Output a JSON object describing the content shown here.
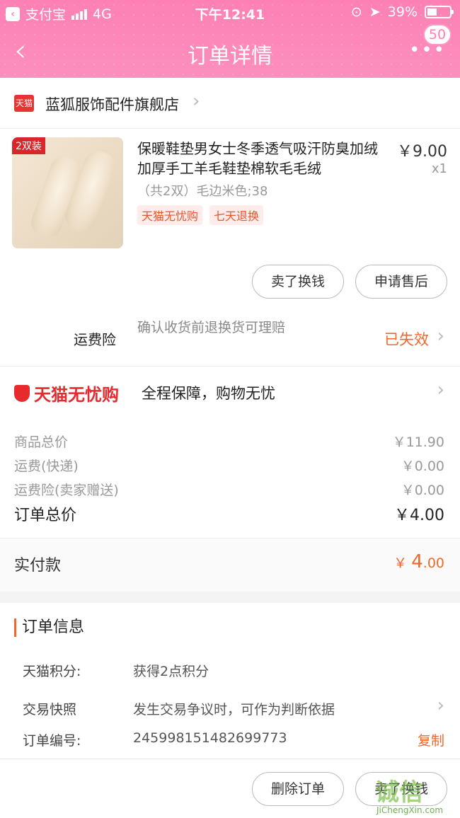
{
  "status_bar": {
    "carrier": "支付宝",
    "network": "4G",
    "time": "下午12:41",
    "battery": "39%"
  },
  "nav": {
    "title": "订单详情",
    "badge": "50",
    "more_label": "•••"
  },
  "shop": {
    "logo_text": "天猫",
    "name": "蓝狐服饰配件旗舰店"
  },
  "product": {
    "image_tag": "2双装",
    "title": "保暖鞋垫男女士冬季透气吸汗防臭加绒加厚手工羊毛鞋垫棉软毛毛绒",
    "spec": "（共2双）毛边米色;38",
    "tags": [
      "天猫无忧购",
      "七天退换"
    ],
    "price": "￥9.00",
    "qty": "x1",
    "buttons": {
      "sell": "卖了换钱",
      "after_sale": "申请售后"
    }
  },
  "shipping_insurance": {
    "label": "运费险",
    "desc": "确认收货前退换货可理赔",
    "status": "已失效"
  },
  "worry_free": {
    "logo": "天猫无忧购",
    "text": "全程保障，购物无忧"
  },
  "totals": {
    "rows": [
      {
        "label": "商品总价",
        "value": "￥11.90"
      },
      {
        "label": "运费(快递)",
        "value": "￥0.00"
      },
      {
        "label": "运费险(卖家赠送)",
        "value": "￥0.00"
      }
    ],
    "order_total_label": "订单总价",
    "order_total": "￥4.00"
  },
  "paid": {
    "label": "实付款",
    "currency": "￥",
    "int": "4",
    "dec": ".00"
  },
  "order_info": {
    "heading": "订单信息",
    "points_label": "天猫积分:",
    "points_value": "获得2点积分",
    "snapshot_label": "交易快照",
    "snapshot_value": "发生交易争议时，可作为判断依据",
    "number_label": "订单编号:",
    "number_value": "2459981514826997​73",
    "copy_label": "复制"
  },
  "bottom_bar": {
    "delete": "删除订单",
    "sell": "卖了换钱"
  },
  "watermark": {
    "big": "诚信",
    "small": "JiChengXin.com"
  },
  "colors": {
    "accent_orange": "#f2672b",
    "header_pink": "#fd80b4",
    "tmall_red": "#e62a2e"
  }
}
